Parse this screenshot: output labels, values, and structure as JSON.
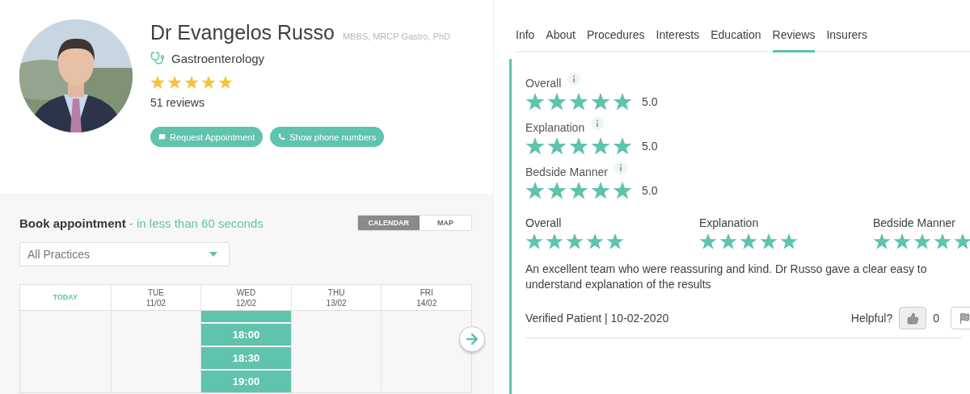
{
  "profile": {
    "name": "Dr Evangelos Russo",
    "credentials": "MBBS, MRCP Gastro, PhD",
    "specialty": "Gastroenterology",
    "stars": 5,
    "reviews_count": "51 reviews",
    "buttons": [
      {
        "kind": "message",
        "label": "Request Appointment"
      },
      {
        "kind": "phone",
        "label": "Show phone numbers"
      }
    ]
  },
  "booking": {
    "title": "Book appointment",
    "subtitle": "- in less than 60 seconds",
    "view_toggle": [
      {
        "label": "CALENDAR",
        "selected": true
      },
      {
        "label": "MAP",
        "selected": false
      }
    ],
    "practice_select": {
      "value": "All Practices"
    },
    "days": [
      {
        "kind": "today",
        "label": "TODAY"
      },
      {
        "kind": "date",
        "day": "TUE",
        "date": "11/02"
      },
      {
        "kind": "date",
        "day": "WED",
        "date": "12/02",
        "more_above": true,
        "slots": [
          "18:00",
          "18:30",
          "19:00"
        ]
      },
      {
        "kind": "date",
        "day": "THU",
        "date": "13/02"
      },
      {
        "kind": "date",
        "day": "FRI",
        "date": "14/02"
      }
    ]
  },
  "tabs": [
    {
      "label": "Info",
      "selected": false
    },
    {
      "label": "About",
      "selected": false
    },
    {
      "label": "Procedures",
      "selected": false
    },
    {
      "label": "Interests",
      "selected": false
    },
    {
      "label": "Education",
      "selected": false
    },
    {
      "label": "Reviews",
      "selected": true
    },
    {
      "label": "Insurers",
      "selected": false
    }
  ],
  "ratings_summary": [
    {
      "label": "Overall",
      "stars": 5,
      "score": "5.0"
    },
    {
      "label": "Explanation",
      "stars": 5,
      "score": "5.0"
    },
    {
      "label": "Bedside Manner",
      "stars": 5,
      "score": "5.0"
    }
  ],
  "review": {
    "ratings": [
      {
        "label": "Overall",
        "stars": 5
      },
      {
        "label": "Explanation",
        "stars": 5
      },
      {
        "label": "Bedside Manner",
        "stars": 5
      }
    ],
    "text": "An excellent team who were reassuring and kind. Dr Russo gave a clear easy to understand explanation of the results",
    "author_line": "Verified Patient | 10-02-2020",
    "helpful_label": "Helpful?",
    "helpful_count": "0"
  }
}
